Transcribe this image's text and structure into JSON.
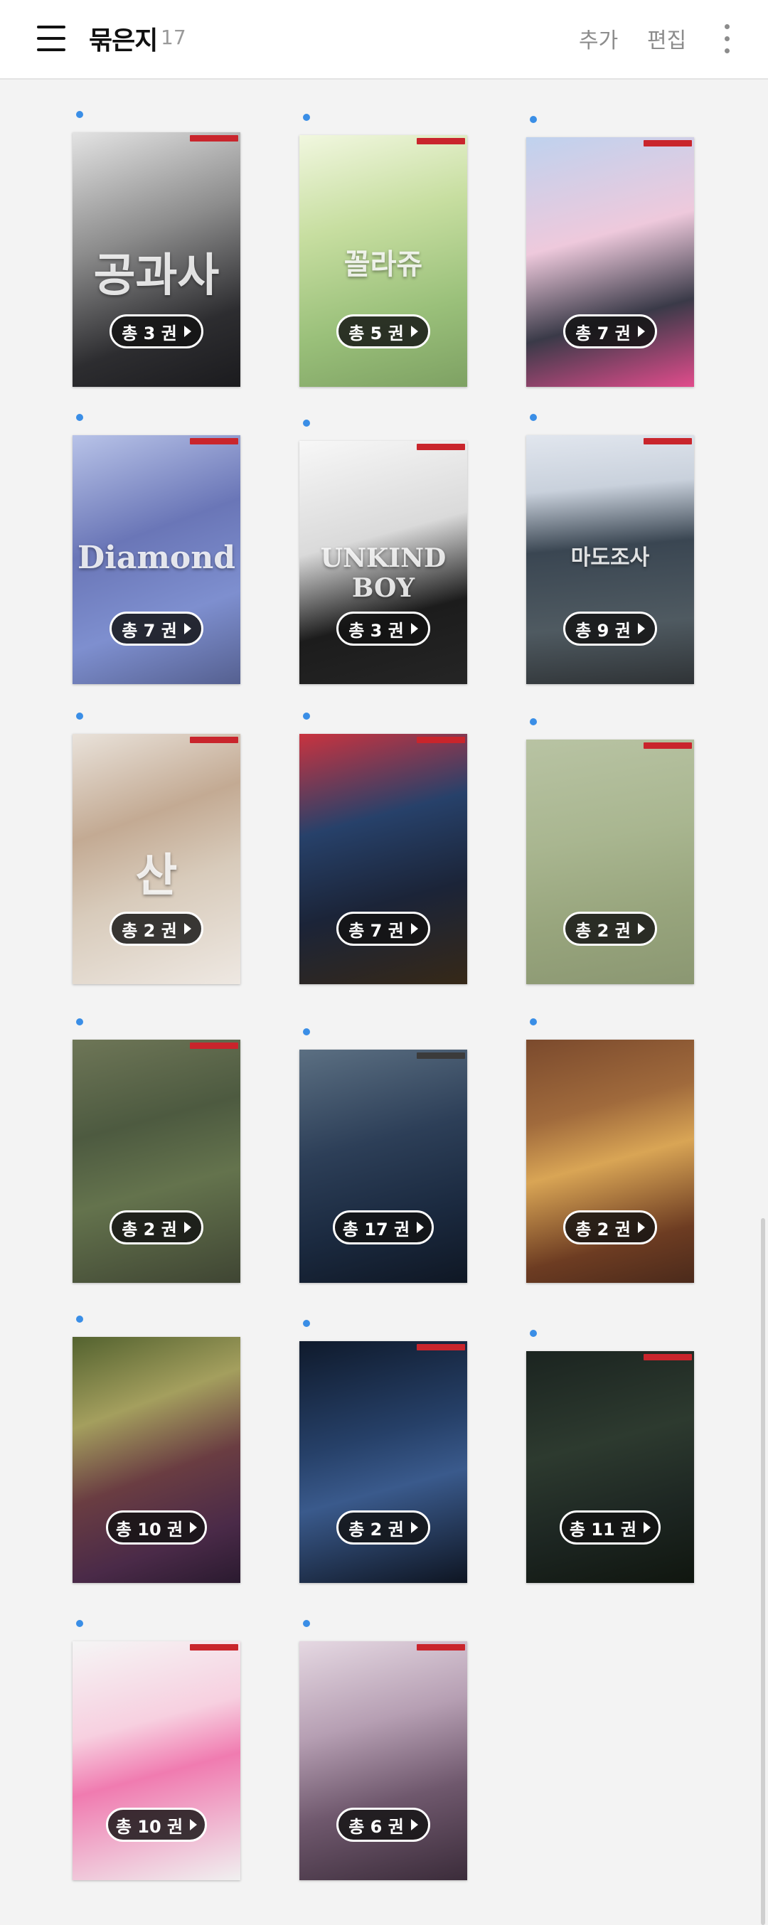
{
  "header": {
    "title": "묶은지",
    "count": "17",
    "add_label": "추가",
    "edit_label": "편집",
    "menu_icon": "hamburger-menu-icon",
    "more_icon": "more-vertical-icon"
  },
  "books": [
    {
      "badge": "총 3 권",
      "cover_text": "공과사"
    },
    {
      "badge": "총 5 권",
      "cover_text": "꼴라쥬"
    },
    {
      "badge": "총 7 권",
      "cover_text": ""
    },
    {
      "badge": "총 7 권",
      "cover_text": "Diamond"
    },
    {
      "badge": "총 3 권",
      "cover_text": "UNKIND BOY"
    },
    {
      "badge": "총 9 권",
      "cover_text": "마도조사"
    },
    {
      "badge": "총 2 권",
      "cover_text": "산"
    },
    {
      "badge": "총 7 권",
      "cover_text": ""
    },
    {
      "badge": "총 2 권",
      "cover_text": ""
    },
    {
      "badge": "총 2 권",
      "cover_text": ""
    },
    {
      "badge": "총 17 권",
      "cover_text": ""
    },
    {
      "badge": "총 2 권",
      "cover_text": ""
    },
    {
      "badge": "총 10 권",
      "cover_text": ""
    },
    {
      "badge": "총 2 권",
      "cover_text": ""
    },
    {
      "badge": "총 11 권",
      "cover_text": ""
    },
    {
      "badge": "총 10 권",
      "cover_text": ""
    },
    {
      "badge": "총 6 권",
      "cover_text": ""
    }
  ],
  "colors": {
    "accent_dot": "#3a8ee6",
    "badge_bg": "#121212",
    "background": "#f3f3f3"
  }
}
